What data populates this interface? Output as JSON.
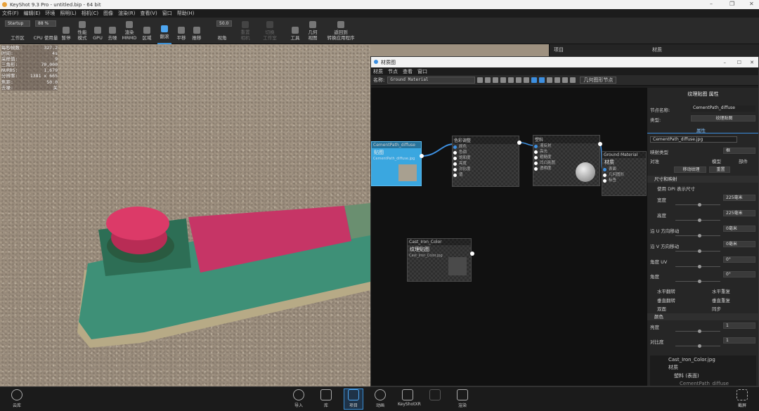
{
  "app": {
    "title": "KeyShot 9.3 Pro - untitled.bip - 64 bit"
  },
  "menu": [
    "文件(F)",
    "编辑(E)",
    "环境",
    "照明(L)",
    "相机(C)",
    "图像",
    "渲染(R)",
    "查看(V)",
    "窗口",
    "帮助(H)"
  ],
  "toolbar": {
    "workspace_value": "Startup",
    "workspace_label": "工作区",
    "cpu_value": "88 %",
    "cpu_label": "CPU 使用量",
    "pause": "暂停",
    "perf": "性能\n模式",
    "gpu": "GPU",
    "denoise": "去噪",
    "render": "渲染\nMRMD",
    "region": "区域",
    "tumble": "翻滚",
    "pan": "平移",
    "dolly": "推移",
    "fov_value": "50.0",
    "fov_label": "视角",
    "reset": "重置\n相机",
    "studio": "切换\n工作室",
    "tools": "工具",
    "geometry": "几何\n视图",
    "send_to": "返回到\n转换应用程序"
  },
  "stats": [
    [
      "每秒帧数:",
      "327.2"
    ],
    [
      "时间:",
      "4s"
    ],
    [
      "采样值:",
      "9"
    ],
    [
      "三角形:",
      "70,000"
    ],
    [
      "NURBS:",
      "1,679"
    ],
    [
      "分辨率:",
      "1381 x 665"
    ],
    [
      "焦距:",
      "50.0"
    ],
    [
      "去噪:",
      "关"
    ]
  ],
  "right_panel": {
    "project": "项目",
    "material": "材质"
  },
  "material_window": {
    "title": "材质图",
    "menu": [
      "材质",
      "节点",
      "查看",
      "窗口"
    ],
    "name_label": "名称:",
    "name_value": "Ground Material",
    "geometry_button": "几何图形节点",
    "nodes": {
      "n1": {
        "header": "CementPath_diffuse",
        "title": "贴图",
        "file": "CementPath_diffuse.jpg"
      },
      "n2": {
        "header": "色彩调整",
        "ports": [
          "颜色",
          "色调",
          "饱和度",
          "亮度",
          "对比度",
          "值"
        ]
      },
      "n3": {
        "header": "塑料",
        "ports": [
          "漫反射",
          "高光",
          "粗糙度",
          "凹凸贴图",
          "透明度"
        ]
      },
      "n4": {
        "header": "Ground Material",
        "title": "材质",
        "ports": [
          "表面",
          "几何图形",
          "标签"
        ]
      },
      "n5": {
        "header": "Cast_Iron_Color",
        "title": "纹理贴图",
        "file": "Cast_Iron_Color.jpg"
      }
    },
    "props": {
      "title": "纹理贴图 属性",
      "node_name_label": "节点名称:",
      "node_name_value": "CementPath_diffuse",
      "type_label": "类型:",
      "type_value": "纹理贴图",
      "tab": "属性",
      "file": "CementPath_diffuse.jpg",
      "map_type_label": "映射类型",
      "map_type_value": "框",
      "align_label": "对准",
      "align_model": "模型",
      "align_part": "部件",
      "move_texture": "移动纹理",
      "reset": "重置",
      "section_size": "尺寸和映射",
      "dpi_label": "使用 DPI 表示尺寸",
      "width_label": "宽度",
      "width_value": "225毫米",
      "height_label": "高度",
      "height_value": "225毫米",
      "u_move_label": "沿 U 方向移动",
      "u_move_value": "0毫米",
      "v_move_label": "沿 V 方向移动",
      "v_move_value": "0毫米",
      "uv_angle_label": "角度 UV",
      "uv_angle_value": "0°",
      "angle_label": "角度",
      "angle_value": "0°",
      "flip_h": "水平翻转",
      "repeat_h": "水平重复",
      "flip_v": "垂直翻转",
      "repeat_v": "垂直重复",
      "double": "双面",
      "sync": "同步",
      "section_color": "颜色",
      "brightness_label": "亮度",
      "brightness_value": "1",
      "contrast_label": "对比度",
      "contrast_value": "1",
      "tree": [
        "Cast_Iron_Color.jpg",
        "材质",
        "塑料 (表面)",
        "CementPath_diffuse"
      ]
    }
  },
  "bottom": {
    "cloud": "云库",
    "import": "导入",
    "library": "库",
    "project": "项目",
    "animation": "动画",
    "keyshotxr": "KeyShotXR",
    "render_btn": "渲染",
    "screenshot": "截屏"
  }
}
